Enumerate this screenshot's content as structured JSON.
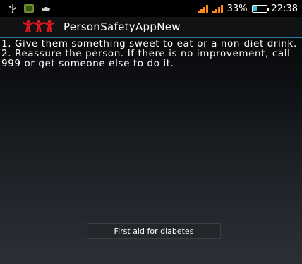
{
  "status_bar": {
    "icons_left": [
      "usb-icon",
      "sim-icon",
      "cat-icon"
    ],
    "signal_color": "#ff8a1a",
    "battery_percent": "33%",
    "battery_level": 0.33,
    "time": "22:38"
  },
  "action_bar": {
    "app_logo": "people-logo-icon",
    "app_title": "PersonSafetyAppNew",
    "logo_color": "#e0181e",
    "divider_color": "#2b7ba3"
  },
  "content": {
    "instructions": [
      "1. Give them something sweet to eat or a non-diet drink.",
      "2. Reassure the person. If there is no improvement, call 999 or get someone else to do it."
    ]
  },
  "toast": {
    "message": "First aid for diabetes"
  }
}
